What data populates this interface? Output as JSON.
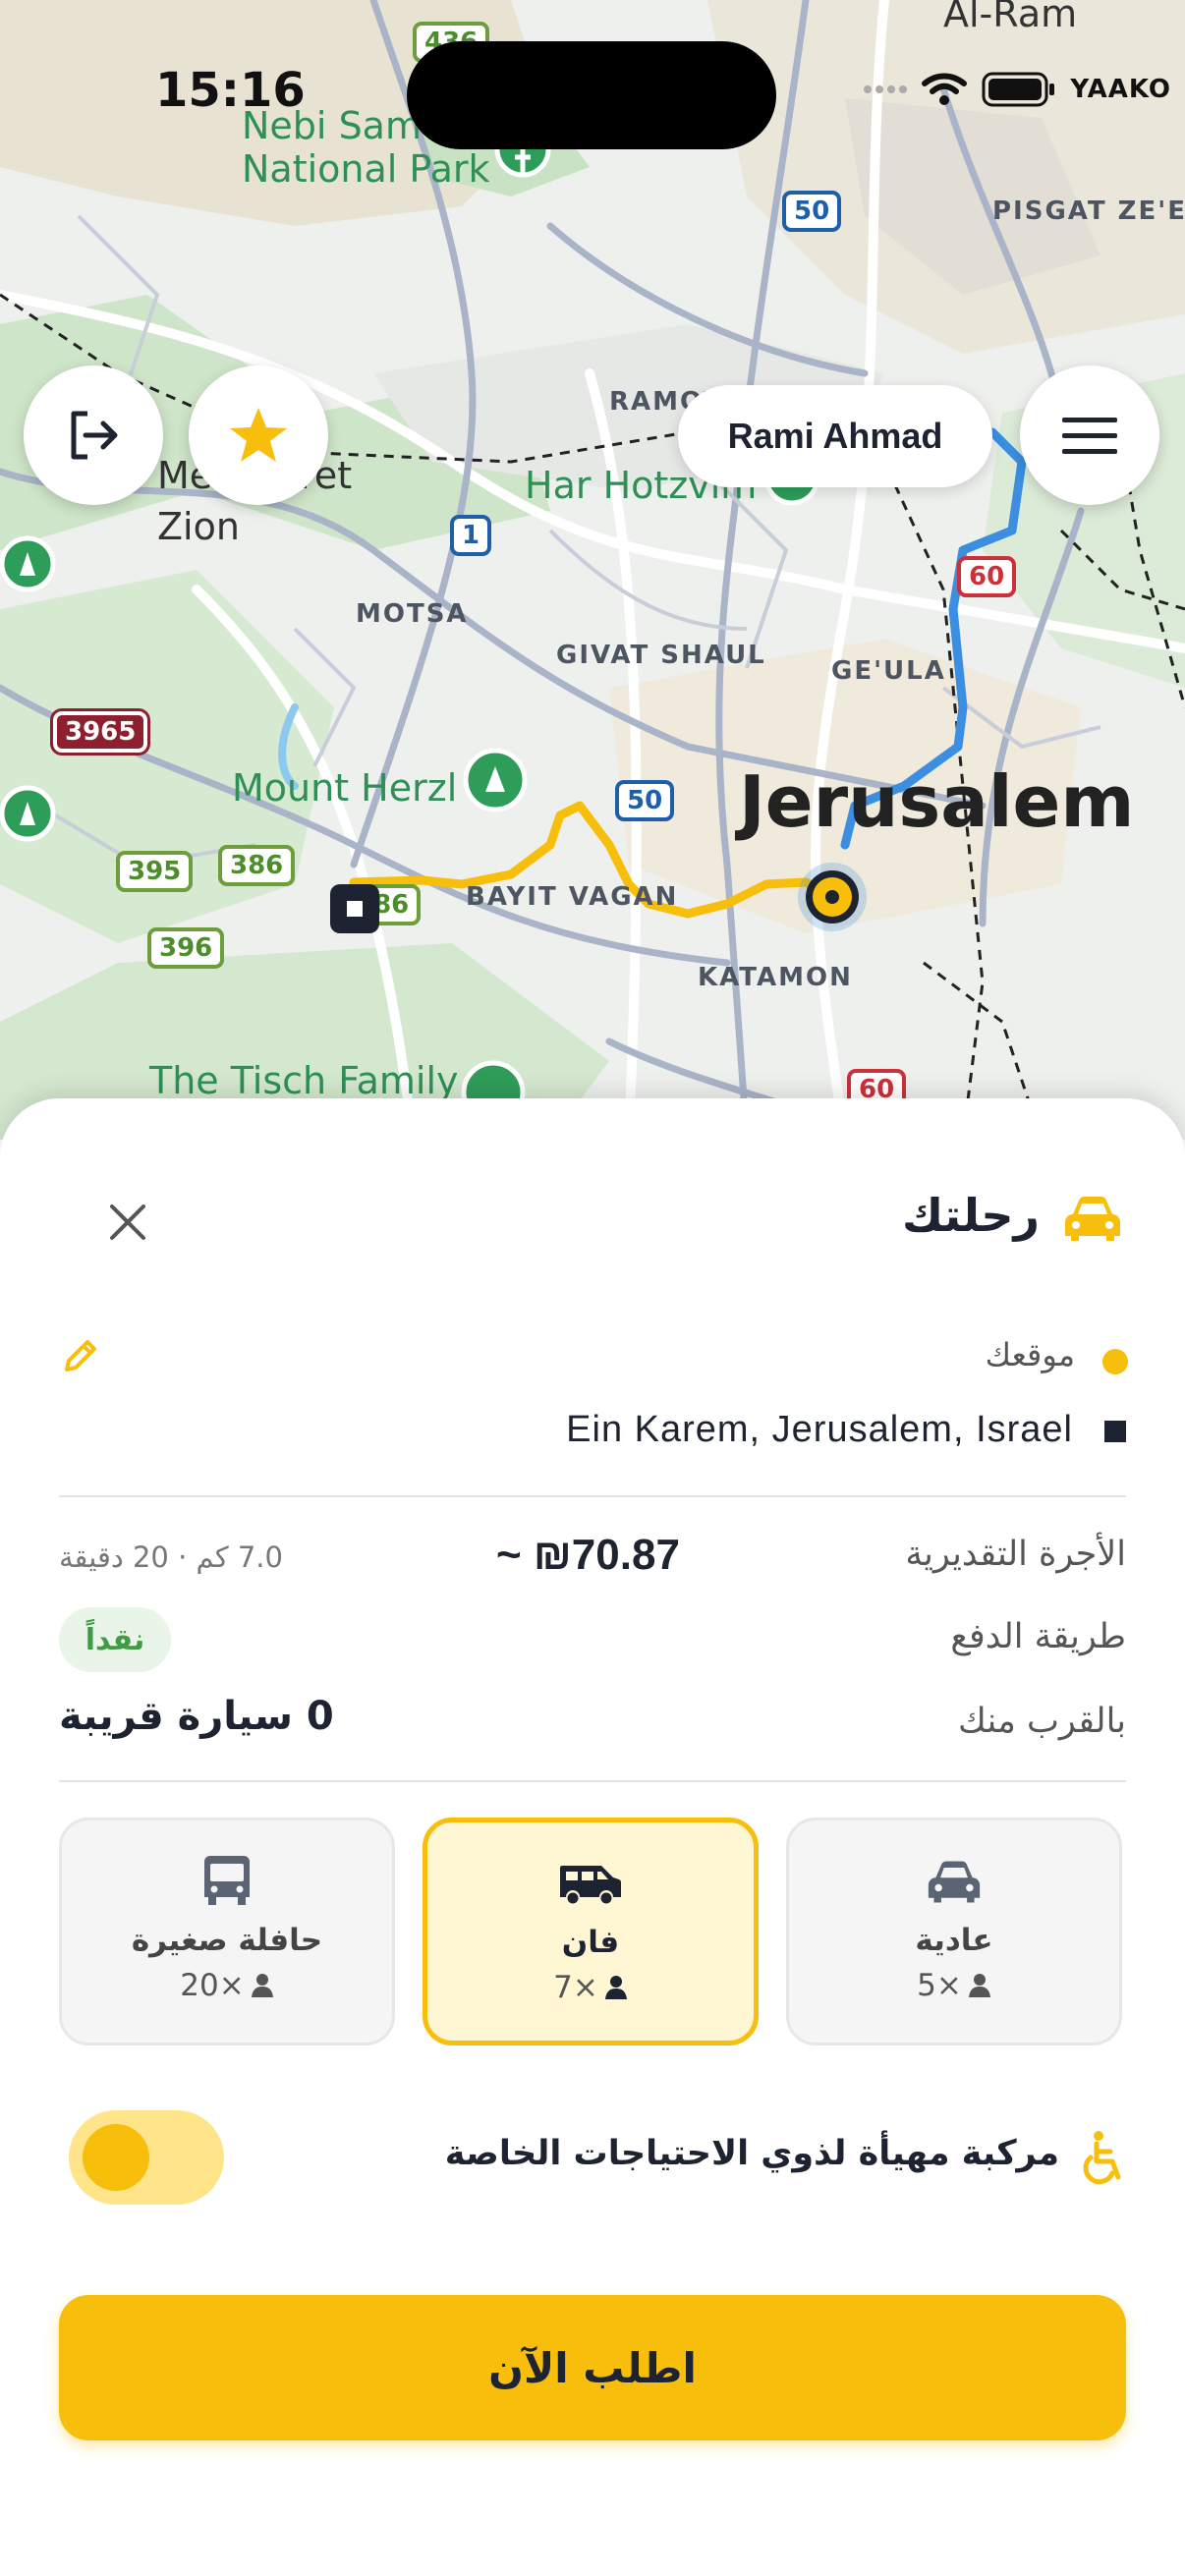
{
  "status_bar": {
    "time": "15:16",
    "carrier": "YAAKO"
  },
  "map": {
    "labels": {
      "al_ram": "Al-Ram",
      "nebi_samwil": "Nebi Samwil\nNational Park",
      "pisgat_zeev": "PISGAT ZE'EV",
      "ramot": "RAMOT",
      "har_hotzvim": "Har Hotzvim",
      "mevaseret_zion": "Mevaseret\nZion",
      "motsa": "MOTSA",
      "givat_shaul": "GIVAT SHAUL",
      "geula": "GE'ULA",
      "mount_herzl": "Mount Herzl",
      "jerusalem": "Jerusalem",
      "bayit_vagan": "BAYIT VAGAN",
      "katamon": "KATAMON",
      "tisch_family": "The Tisch Family"
    },
    "shields": {
      "r436": "436",
      "r50a": "50",
      "r1": "1",
      "r60a": "60",
      "r3965": "3965",
      "r395": "395",
      "r386": "386",
      "r396": "396",
      "r386b": "386",
      "r50b": "50",
      "r60b": "60"
    }
  },
  "header": {
    "user_name": "Rami Ahmad"
  },
  "icons": {
    "logout": "logout-icon",
    "favorites": "star-icon",
    "menu": "menu-icon",
    "car": "car-icon",
    "close": "close-icon",
    "edit": "pencil-icon",
    "bus": "bus-icon",
    "van": "van-icon",
    "person": "person-icon",
    "accessibility": "wheelchair-icon"
  },
  "colors": {
    "accent": "#f8be0c",
    "route": "#f8be0c",
    "route_blue": "#3b8ee0",
    "cash": "#3f9b45"
  },
  "trip": {
    "title": "رحلتك",
    "origin": "موقعك",
    "destination": "Ein Karem, Jerusalem, Israel",
    "fare_label": "الأجرة التقديرية",
    "fare_value": "~ ₪70.87",
    "meta": "7.0 كم · 20 دقيقة",
    "payment_label": "طريقة الدفع",
    "payment_value": "نقداً",
    "nearby_label": "بالقرب منك",
    "nearby_value": "0 سيارة قريبة"
  },
  "vehicles": [
    {
      "name": "حافلة صغيرة",
      "capacity": "20×",
      "selected": false
    },
    {
      "name": "فان",
      "capacity": "7×",
      "selected": true
    },
    {
      "name": "عادية",
      "capacity": "5×",
      "selected": false
    }
  ],
  "accessibility": {
    "label": "مركبة مهيأة لذوي الاحتياجات الخاصة",
    "enabled": false
  },
  "order_button": {
    "label": "اطلب الآن"
  }
}
